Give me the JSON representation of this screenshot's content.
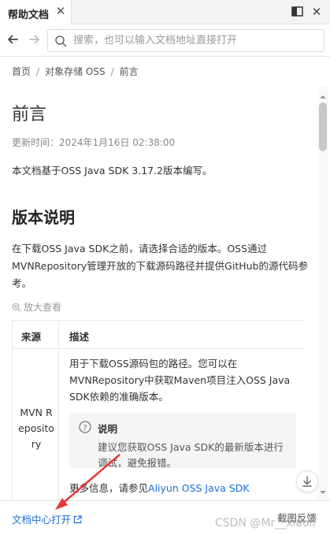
{
  "tab": {
    "title": "帮助文档",
    "close_icon": "close-icon"
  },
  "window": {
    "split_icon": "split-view-icon",
    "close_icon": "close-icon"
  },
  "nav": {
    "back_icon": "arrow-left-icon",
    "forward_icon": "arrow-right-icon",
    "search_icon": "search-icon",
    "search_placeholder": "搜索，也可以输入文档地址直接打开",
    "search_value": ""
  },
  "breadcrumb": {
    "items": [
      "首页",
      "对象存储 OSS",
      "前言"
    ],
    "separator": "/"
  },
  "article": {
    "title": "前言",
    "updated": "更新时间：2024年1月16日 02:38:00",
    "intro": "本文档基于OSS Java SDK 3.17.2版本编写。",
    "section_title": "版本说明",
    "section_desc": "在下载OSS Java SDK之前，请选择合适的版本。OSS通过MVNRepository管理开放的下载源码路径并提供GitHub的源代码参考。",
    "zoom_label": "放大查看",
    "table": {
      "headers": [
        "来源",
        "描述"
      ],
      "rows": [
        {
          "source": "MVN Repository",
          "description": "用于下载OSS源码包的路径。您可以在MVNRepository中获取Maven项目注入OSS Java SDK依赖的准确版本。",
          "note_title": "说明",
          "note_body": "建议您获取OSS Java SDK的最新版本进行调试，避免报错。",
          "more_prefix": "更多信息，请参见",
          "more_link": "Aliyun OSS Java SDK"
        }
      ]
    }
  },
  "footer": {
    "open_link": "文档中心打开",
    "feedback": "截图反馈",
    "watermark": "CSDN @Mr__xiaoli"
  },
  "colors": {
    "link": "#1a6fd8",
    "annotation_arrow": "#e53935"
  }
}
